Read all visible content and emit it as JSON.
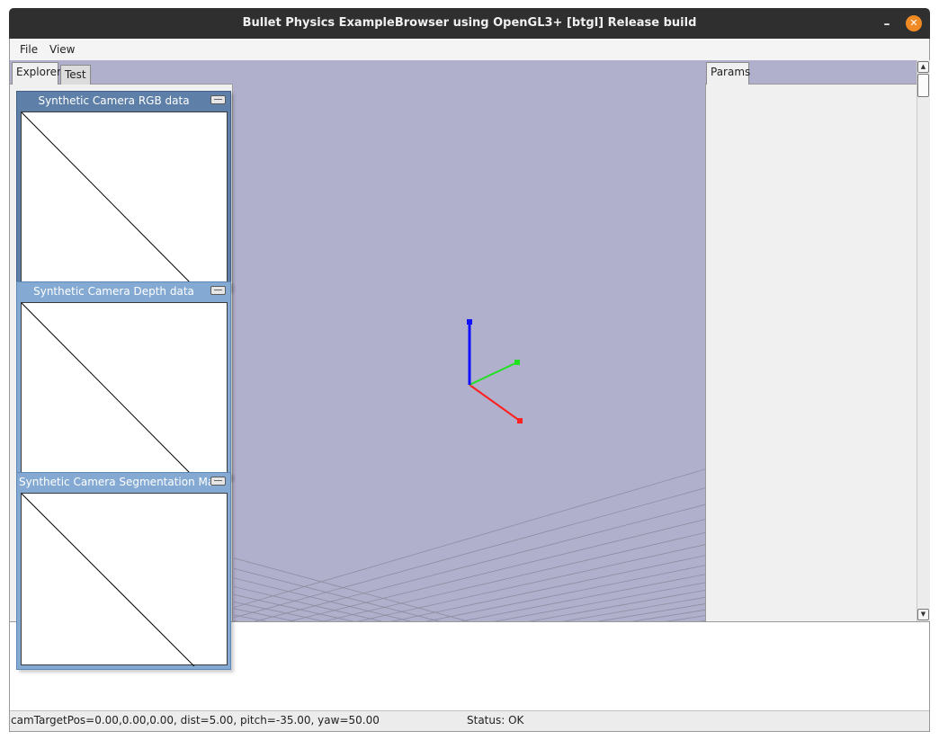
{
  "window": {
    "title": "Bullet Physics ExampleBrowser using OpenGL3+ [btgl] Release build",
    "minimize_glyph": "–",
    "close_glyph": "✕",
    "close_color": "#f08a24"
  },
  "menubar": {
    "items": [
      "File",
      "View"
    ]
  },
  "explorer": {
    "tabs": [
      "Explorer",
      "Test"
    ]
  },
  "params": {
    "tab": "Params"
  },
  "camera_windows": [
    {
      "title": "Synthetic Camera RGB data"
    },
    {
      "title": "Synthetic Camera Depth data"
    },
    {
      "title": "Synthetic Camera Segmentation Mask"
    }
  ],
  "viewport": {
    "background": "#b0b0cc",
    "axis_colors": {
      "x": "#ff2020",
      "y": "#20e020",
      "z": "#1010ff"
    }
  },
  "statusbar": {
    "camera": "camTargetPos=0.00,0.00,0.00, dist=5.00, pitch=-35.00, yaw=50.00",
    "status": "Status: OK"
  },
  "scrollbar": {
    "up_icon": "▲",
    "down_icon": "▼"
  }
}
